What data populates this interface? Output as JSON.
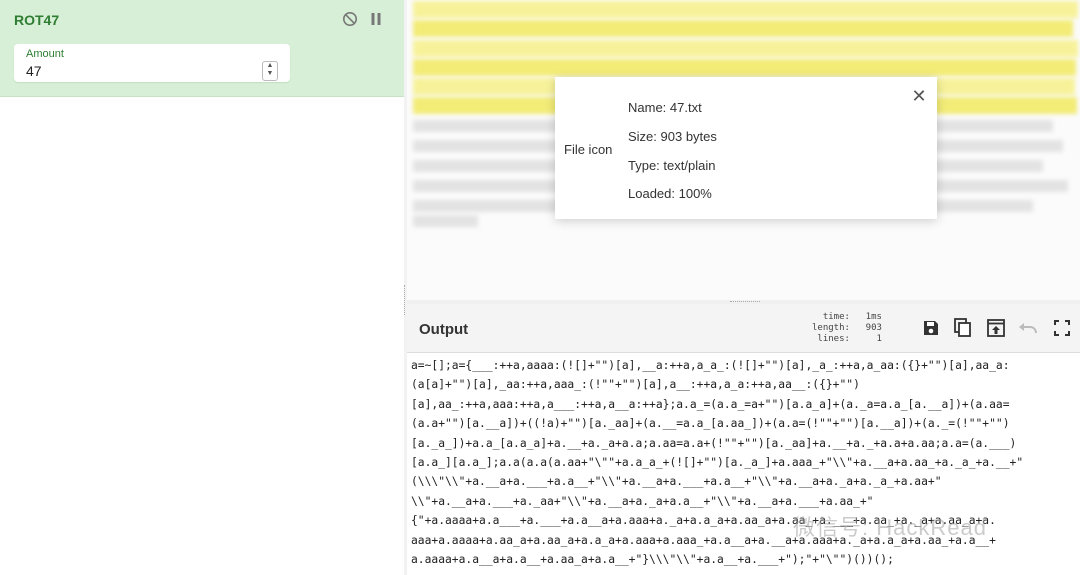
{
  "operation": {
    "title": "ROT47",
    "amount_label": "Amount",
    "amount_value": "47"
  },
  "file_popup": {
    "icon_text": "File icon",
    "name": "Name: 47.txt",
    "size": "Size: 903 bytes",
    "type": "Type: text/plain",
    "loaded": "Loaded: 100%"
  },
  "output": {
    "title": "Output",
    "stats": [
      {
        "key": "time:",
        "value": "1ms"
      },
      {
        "key": "length:",
        "value": "903"
      },
      {
        "key": "lines:",
        "value": "1"
      }
    ],
    "lines": [
      "a=~[];a={___:++a,aaaa:(![]+\"\")[a],__a:++a,a_a_:(![]+\"\")[a],_a_:++a,a_aa:({}+\"\")[a],aa_a:",
      "(a[a]+\"\")[a],_aa:++a,aaa_:(!\"\"+\"\")[a],a__:++a,a_a:++a,aa__:({}+\"\")",
      "[a],aa_:++a,aaa:++a,a___:++a,a__a:++a};a.a_=(a.a_=a+\"\")[a.a_a]+(a._a=a.a_[a.__a])+(a.aa=",
      "(a.a+\"\")[a.__a])+((!a)+\"\")[a._aa]+(a.__=a.a_[a.aa_])+(a.a=(!\"\"+\"\")[a.__a])+(a._=(!\"\"+\"\")",
      "[a._a_])+a.a_[a.a_a]+a.__+a._a+a.a;a.aa=a.a+(!\"\"+\"\")[a._aa]+a.__+a._+a.a+a.aa;a.a=(a.___)",
      "[a.a_][a.a_];a.a(a.a(a.aa+\"\\\"\"+a.a_a_+(![]+\"\")[a._a_]+a.aaa_+\"\\\\\"+a.__a+a.aa_+a._a_+a.__+\"",
      "(\\\\\\\"\\\\\"+a.__a+a.___+a.a__+\"\\\\\"+a.__a+a.___+a.a__+\"\\\\\"+a.__a+a._a+a._a_+a.aa+\"",
      "\\\\\"+a.__a+a.___+a._aa+\"\\\\\"+a.__a+a._a+a.a__+\"\\\\\"+a.__a+a.___+a.aa_+\"",
      "{\"+a.aaaa+a.a___+a.___+a.a__a+a.aaa+a._a+a.a_a+a.aa_a+a.aa_+a.___+a.aa_+a._a+a.aa_a+a.",
      "aaa+a.aaaa+a.aa_a+a.aa_a+a.a_a+a.aaa+a.aaa_+a.a__a+a.__a+a.aaa+a._a+a.a_a+a.aa_+a.a__+",
      "a.aaaa+a.a__a+a.a__+a.aa_a+a.a__+\"}\\\\\\\"\\\\\"+a.a__+a.___+\");\"+\"\\\"\")())();"
    ]
  },
  "watermark": "微信号: HackRead",
  "colors": {
    "op_bg": "#d6efd6",
    "op_title": "#2e7d32",
    "input_highlight": "#f7f29a"
  }
}
